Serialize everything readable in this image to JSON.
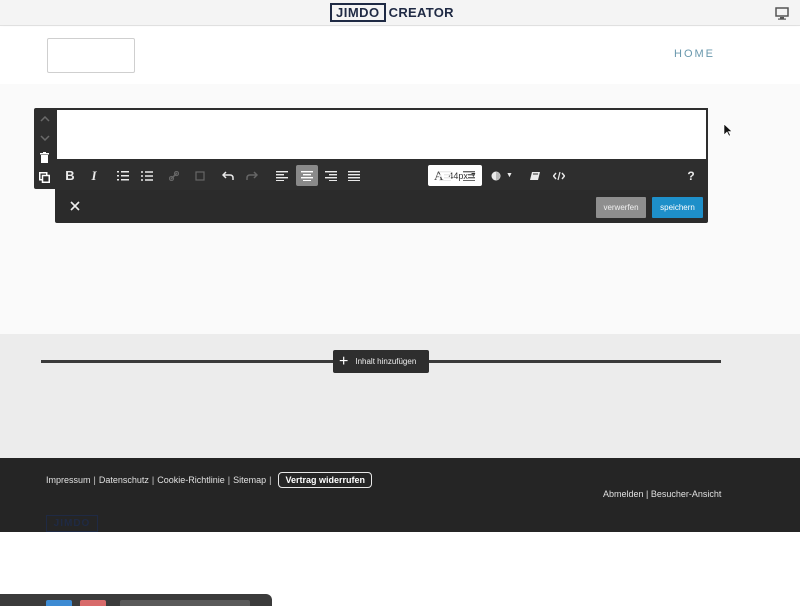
{
  "topbar": {
    "brand_box": "JIMDO",
    "brand_text": "CREATOR",
    "monitor_icon": "monitor-icon"
  },
  "header": {
    "nav_home": "HOME"
  },
  "editor": {
    "font_size": "44px",
    "help": "?",
    "discard_label": "verwerfen",
    "save_label": "speichern"
  },
  "add_content": {
    "label": "Inhalt hinzufügen"
  },
  "footer": {
    "links": [
      "Impressum",
      "Datenschutz",
      "Cookie-Richtlinie",
      "Sitemap"
    ],
    "contract_button": "Vertrag widerrufen",
    "right_links": "Abmelden | Besucher-Ansicht",
    "logo": "JIMDO"
  },
  "colors": {
    "accent_blue": "#1e8fc9",
    "toolbar_dark": "#2e2e2e",
    "brand_navy": "#1f2a44",
    "nav_text": "#6a98ad"
  }
}
